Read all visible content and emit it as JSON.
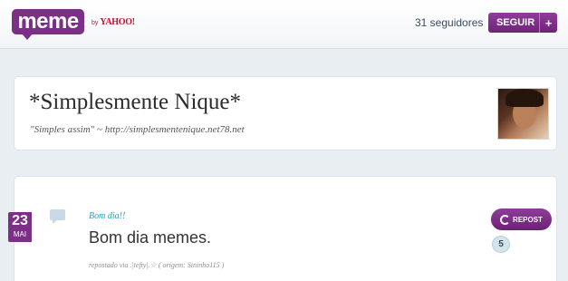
{
  "header": {
    "logo_text": "meme",
    "by_label": "by",
    "yahoo_label": "YAHOO!",
    "followers_text": "31 seguidores",
    "follow_label": "SEGUIR",
    "plus_label": "+"
  },
  "profile": {
    "name": "*Simplesmente Nique*",
    "description": "\"Simples assim\" ~ http://simplesmentenique.net78.net"
  },
  "post": {
    "day": "23",
    "month": "MAI",
    "title": "Bom dia!!",
    "body": "Bom dia memes.",
    "meta": "repostado via .|tefty|.☆ ( origem: Sininho115 )",
    "repost_label": "REPOST",
    "repost_count": "5",
    "type_icon": "speech-bubble-icon"
  },
  "colors": {
    "brand": "#7b2f86",
    "link": "#2a9bbd",
    "background": "#e9eef2"
  }
}
